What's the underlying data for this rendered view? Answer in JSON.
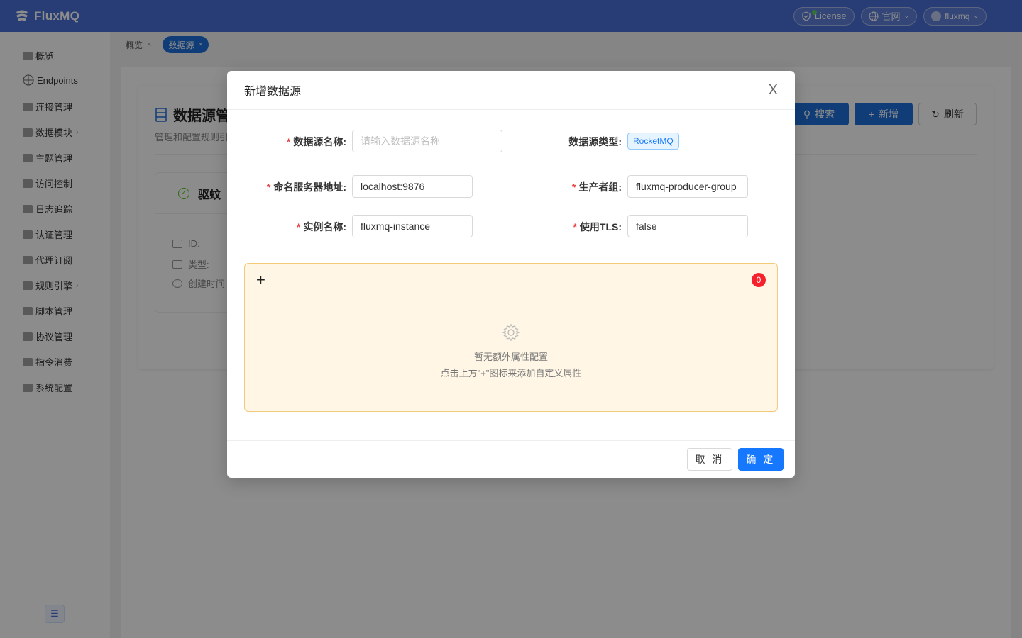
{
  "header": {
    "logo_text": "FluxMQ",
    "license_label": "License",
    "site_label": "官网",
    "user_label": "fluxmq"
  },
  "sidebar": {
    "items": [
      {
        "label": "概览",
        "icon": "dashboard-icon"
      },
      {
        "label": "Endpoints",
        "icon": "globe-icon"
      },
      {
        "label": "连接管理",
        "icon": "connection-icon"
      },
      {
        "label": "数据模块",
        "icon": "data-module-icon",
        "has_children": true
      },
      {
        "label": "主题管理",
        "icon": "hash-icon"
      },
      {
        "label": "访问控制",
        "icon": "access-icon"
      },
      {
        "label": "日志追踪",
        "icon": "log-icon"
      },
      {
        "label": "认证管理",
        "icon": "auth-icon"
      },
      {
        "label": "代理订阅",
        "icon": "proxy-icon"
      },
      {
        "label": "规则引擎",
        "icon": "rule-engine-icon",
        "has_children": true
      },
      {
        "label": "脚本管理",
        "icon": "script-icon"
      },
      {
        "label": "协议管理",
        "icon": "protocol-icon"
      },
      {
        "label": "指令消费",
        "icon": "command-icon"
      },
      {
        "label": "系统配置",
        "icon": "system-icon"
      }
    ],
    "collapse_icon": "menu-fold-icon"
  },
  "tabs": [
    {
      "label": "概览",
      "active": false
    },
    {
      "label": "数据源",
      "active": true
    }
  ],
  "page": {
    "title": "数据源管",
    "subtitle": "管理和配置规则引",
    "search_label": "搜索",
    "add_label": "新增",
    "refresh_label": "刷新",
    "card": {
      "name": "驱蚊",
      "id_label": "ID:",
      "type_label": "类型:",
      "created_label": "创建时间"
    }
  },
  "modal": {
    "title": "新增数据源",
    "close_label": "X",
    "fields": {
      "name": {
        "label": "数据源名称:",
        "placeholder": "请输入数据源名称",
        "value": "",
        "required": true
      },
      "type": {
        "label": "数据源类型:",
        "value": "RocketMQ",
        "required": false
      },
      "nameserver": {
        "label": "命名服务器地址:",
        "value": "localhost:9876",
        "required": true
      },
      "producer_group": {
        "label": "生产者组:",
        "value": "fluxmq-producer-group",
        "required": true
      },
      "instance": {
        "label": "实例名称:",
        "value": "fluxmq-instance",
        "required": true
      },
      "tls": {
        "label": "使用TLS:",
        "value": "false",
        "required": true
      }
    },
    "required_mark": "*",
    "props": {
      "add_label": "+",
      "count": "0",
      "empty_title": "暂无额外属性配置",
      "empty_hint": "点击上方\"+\"图标来添加自定义属性"
    },
    "cancel_label": "取 消",
    "ok_label": "确 定"
  },
  "colors": {
    "header_bg": "#4a6fd6",
    "primary": "#1677ff",
    "required": "#e84343",
    "props_bg": "#fff6e5",
    "badge": "#f5222d"
  }
}
